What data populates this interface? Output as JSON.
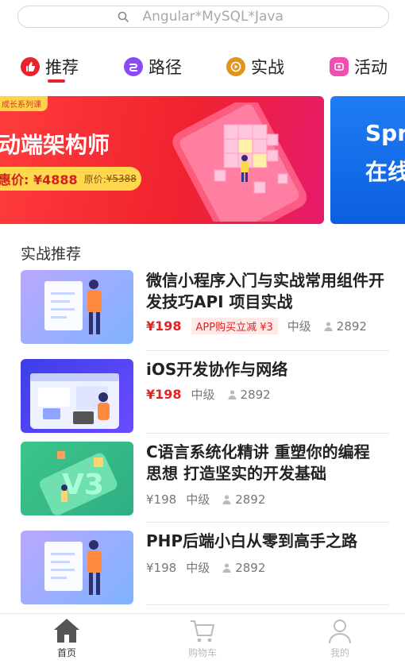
{
  "search": {
    "placeholder": "Angular*MySQL*Java"
  },
  "nav": [
    {
      "label": "推荐",
      "icon": "thumbs-up-icon",
      "color": "#e8232c",
      "active": true
    },
    {
      "label": "路径",
      "icon": "path-icon",
      "color": "#8a4cf2"
    },
    {
      "label": "实战",
      "icon": "play-icon",
      "color": "#e0951c"
    },
    {
      "label": "活动",
      "icon": "gift-icon",
      "color": "#ee4fb1"
    }
  ],
  "banners": [
    {
      "tag": "成长系列课",
      "title": "动端架构师",
      "price_now": "惠价: ¥4888",
      "price_orig_label": "原价:",
      "price_orig": "¥5388"
    },
    {
      "line1": "Spr",
      "line2": "在线"
    }
  ],
  "section_title": "实战推荐",
  "courses": [
    {
      "title": "微信小程序入门与实战常用组件开发技巧API 项目实战",
      "price": "¥198",
      "price_style": "red",
      "promo": "APP购买立减 ¥3",
      "level": "中级",
      "students": "2892"
    },
    {
      "title": "iOS开发协作与网络",
      "price": "¥198",
      "price_style": "red",
      "promo": "",
      "level": "中级",
      "students": "2892"
    },
    {
      "title": "C语言系统化精讲 重塑你的编程思想 打造坚实的开发基础",
      "price": "¥198",
      "price_style": "gray",
      "promo": "",
      "level": "中级",
      "students": "2892"
    },
    {
      "title": "PHP后端小白从零到高手之路",
      "price": "¥198",
      "price_style": "gray",
      "promo": "",
      "level": "中级",
      "students": "2892"
    }
  ],
  "tabbar": [
    {
      "label": "首页",
      "icon": "home-icon",
      "active": true
    },
    {
      "label": "购物车",
      "icon": "cart-icon",
      "active": false
    },
    {
      "label": "我的",
      "icon": "user-icon",
      "active": false
    }
  ],
  "colors": {
    "accent": "#e8232c",
    "price_red": "#e32121",
    "tab_active": "#333333",
    "tab_inactive": "#bbbbbb"
  }
}
